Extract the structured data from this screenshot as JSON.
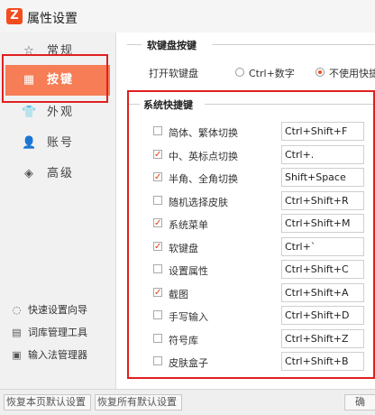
{
  "window": {
    "title": "属性设置",
    "logo_text": "Z"
  },
  "sidebar": {
    "items": [
      {
        "label": "常规",
        "icon": "☆"
      },
      {
        "label": "按键",
        "icon": "▦"
      },
      {
        "label": "外观",
        "icon": "👕"
      },
      {
        "label": "账号",
        "icon": "👤"
      },
      {
        "label": "高级",
        "icon": "◈"
      }
    ],
    "tools": [
      {
        "label": "快速设置向导",
        "icon": "◌"
      },
      {
        "label": "词库管理工具",
        "icon": "▤"
      },
      {
        "label": "输入法管理器",
        "icon": "▣"
      }
    ]
  },
  "soft_keyboard": {
    "section_title": "软键盘按键",
    "row_label": "打开软键盘",
    "option1": "Ctrl+数字",
    "option2": "不使用快捷",
    "selected": "option2"
  },
  "shortcuts": {
    "section_title": "系统快捷键",
    "rows": [
      {
        "label": "简体、繁体切换",
        "key": "Ctrl+Shift+F",
        "checked": false
      },
      {
        "label": "中、英标点切换",
        "key": "Ctrl+.",
        "checked": true
      },
      {
        "label": "半角、全角切换",
        "key": "Shift+Space",
        "checked": true
      },
      {
        "label": "随机选择皮肤",
        "key": "Ctrl+Shift+R",
        "checked": false
      },
      {
        "label": "系统菜单",
        "key": "Ctrl+Shift+M",
        "checked": true
      },
      {
        "label": "软键盘",
        "key": "Ctrl+`",
        "checked": true
      },
      {
        "label": "设置属性",
        "key": "Ctrl+Shift+C",
        "checked": false
      },
      {
        "label": "截图",
        "key": "Ctrl+Shift+A",
        "checked": true
      },
      {
        "label": "手写输入",
        "key": "Ctrl+Shift+D",
        "checked": false
      },
      {
        "label": "符号库",
        "key": "Ctrl+Shift+Z",
        "checked": false
      },
      {
        "label": "皮肤盒子",
        "key": "Ctrl+Shift+B",
        "checked": false
      }
    ]
  },
  "footer": {
    "reset_page": "恢复本页默认设置",
    "reset_all": "恢复所有默认设置",
    "right_btn": "确"
  },
  "colors": {
    "accent": "#f67d55",
    "brand": "#f24d1f",
    "highlight_box": "#e02020"
  }
}
